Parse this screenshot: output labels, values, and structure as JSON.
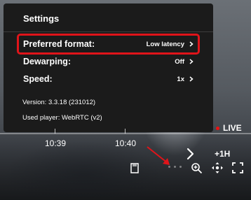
{
  "settings": {
    "title": "Settings",
    "rows": [
      {
        "label": "Preferred format:",
        "value": "Low latency"
      },
      {
        "label": "Dewarping:",
        "value": "Off"
      },
      {
        "label": "Speed:",
        "value": "1x"
      }
    ],
    "version": "Version: 3.3.18 (231012)",
    "player": "Used player: WebRTC (v2)"
  },
  "timeline": {
    "labels": [
      "10:39",
      "10:40"
    ],
    "live_label": "LIVE",
    "jump_label": "+1H"
  },
  "controls": {
    "icons": [
      "sd-card-icon",
      "more-dots-icon",
      "zoom-in-icon",
      "pan-move-icon",
      "fullscreen-icon"
    ]
  },
  "colors": {
    "highlight": "#e0141a",
    "live": "#e11111",
    "panel": "#1b1b1b"
  }
}
